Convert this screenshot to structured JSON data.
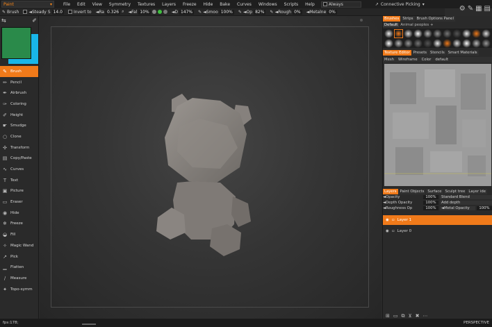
{
  "menubar": {
    "workspace": "Paint",
    "items": [
      "File",
      "Edit",
      "View",
      "Symmetry",
      "Textures",
      "Layers",
      "Freeze",
      "Hide",
      "Bake",
      "Curves",
      "Windows",
      "Scripts",
      "Help"
    ],
    "always": "Always",
    "picking": "Connective Picking"
  },
  "tooloptions": {
    "tool": "Brush",
    "steady": "◄Steady S",
    "steady_val": "14.0",
    "invert": "Invert",
    "invert_suffix": "to",
    "ra": "◄Ra",
    "ra_val": "0.326",
    "fal": "◄Fal",
    "fal_val": "10%",
    "d": "◄D",
    "d_val": "147%",
    "smoo": "◄Smoo",
    "smoo_val": "100%",
    "op": "◄Op",
    "op_val": "82%",
    "rough": "◄Rough",
    "rough_val": "0%",
    "metal": "◄Metalne",
    "metal_val": "0%"
  },
  "tools": [
    {
      "label": "Brush",
      "icon": "✎"
    },
    {
      "label": "Pencil",
      "icon": "✏"
    },
    {
      "label": "Airbrush",
      "icon": "✒"
    },
    {
      "label": "Coloring",
      "icon": "✑"
    },
    {
      "label": "Height",
      "icon": "✐"
    },
    {
      "label": "Smudge",
      "icon": "☛"
    },
    {
      "label": "Clone",
      "icon": "○"
    },
    {
      "label": "Transform",
      "icon": "✣"
    },
    {
      "label": "Copy/Paste",
      "icon": "▤"
    },
    {
      "label": "Curves",
      "icon": "∿"
    },
    {
      "label": "Text",
      "icon": "T"
    },
    {
      "label": "Picture",
      "icon": "▣"
    },
    {
      "label": "Eraser",
      "icon": "▭"
    },
    {
      "label": "Hide",
      "icon": "◉"
    },
    {
      "label": "Freeze",
      "icon": "❄"
    },
    {
      "label": "Fill",
      "icon": "◒"
    },
    {
      "label": "Magic Wand",
      "icon": "✧"
    },
    {
      "label": "Pick",
      "icon": "↗"
    },
    {
      "label": "Flatten",
      "icon": "▁"
    },
    {
      "label": "Measure",
      "icon": "∕"
    },
    {
      "label": "Topo-symm",
      "icon": "✦"
    }
  ],
  "colors": {
    "primary": "#2a8a4a",
    "secondary": "#19b6e8",
    "accent": "#f07a1a"
  },
  "brushes_tabs": [
    "Brushes",
    "Strips",
    "Brush Options Panel"
  ],
  "brush_set": {
    "default": "Default",
    "other": "Animal peoples",
    "add": "+"
  },
  "texture_tabs": [
    "Texture Editor",
    "Presets",
    "Stencils",
    "Smart Materials"
  ],
  "texture_bar": {
    "mesh": "Mesh",
    "mode": "Wireframe",
    "channel": "Color",
    "preset": "default"
  },
  "layer_tabs": [
    "Layers",
    "Paint Objects",
    "Surface",
    "Sculpt tree",
    "Layer ide"
  ],
  "layer_props": [
    {
      "name": "◄Opacity",
      "value": "100%",
      "option": "Standard Blend"
    },
    {
      "name": "◄Depth Opacity",
      "value": "100%",
      "option": "Add depth"
    },
    {
      "name": "◄Roughness Op",
      "value": "100%",
      "option": "◄Metal Opacity"
    }
  ],
  "layer_props_extra": "100%",
  "layers": [
    {
      "name": "Layer 1",
      "active": true
    },
    {
      "name": "Layer 0",
      "active": false
    }
  ],
  "status": {
    "fps": "fps:178;",
    "view": "PERSPECTIVE"
  }
}
